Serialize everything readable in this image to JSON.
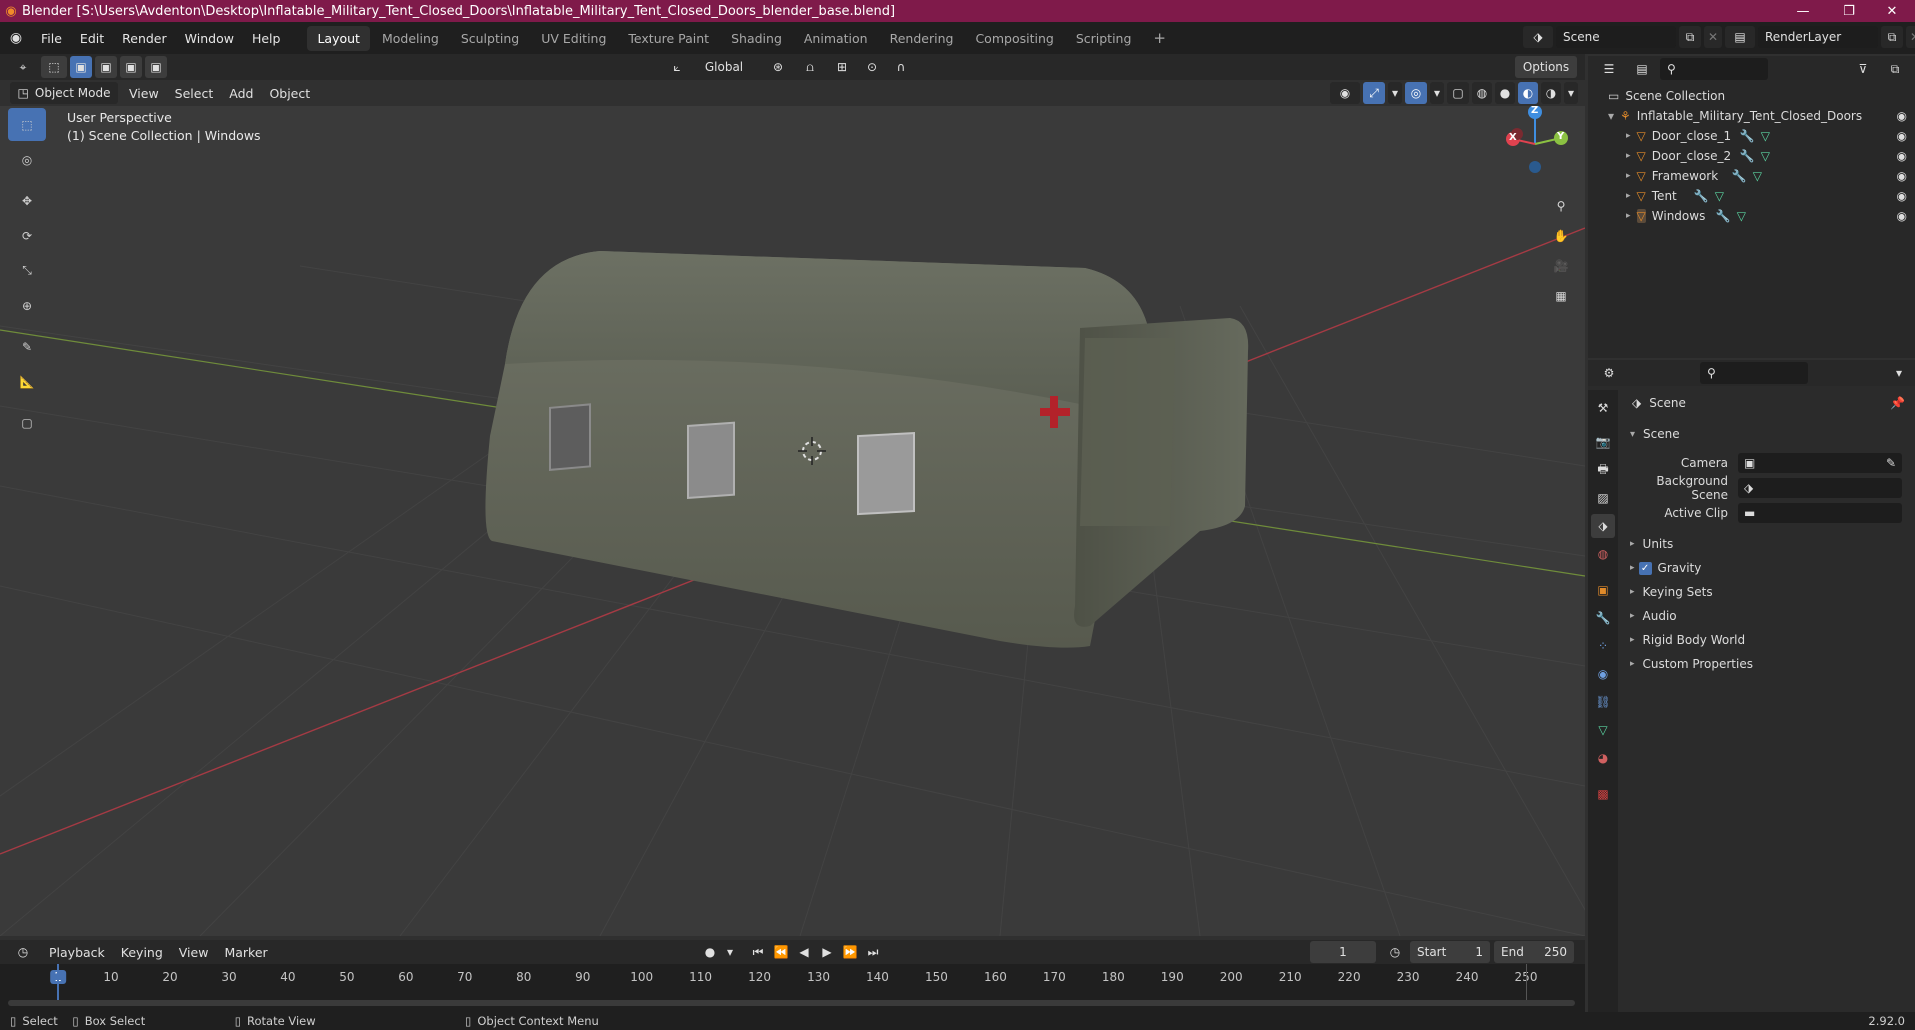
{
  "window": {
    "title": "Blender [S:\\Users\\Avdenton\\Desktop\\Inflatable_Military_Tent_Closed_Doors\\Inflatable_Military_Tent_Closed_Doors_blender_base.blend]"
  },
  "menus": [
    "File",
    "Edit",
    "Render",
    "Window",
    "Help"
  ],
  "workspaces": [
    "Layout",
    "Modeling",
    "Sculpting",
    "UV Editing",
    "Texture Paint",
    "Shading",
    "Animation",
    "Rendering",
    "Compositing",
    "Scripting"
  ],
  "active_workspace": "Layout",
  "scene_selector": {
    "value": "Scene"
  },
  "view_layer_selector": {
    "value": "RenderLayer"
  },
  "viewport_header": {
    "transform_orientation": "Global",
    "options_label": "Options",
    "mode": "Object Mode",
    "menus": [
      "View",
      "Select",
      "Add",
      "Object"
    ]
  },
  "viewport": {
    "perspective_label": "User Perspective",
    "collection_label": "(1) Scene Collection | Windows",
    "gizmo_axes": {
      "x": "X",
      "y": "Y",
      "z": "Z"
    }
  },
  "outliner": {
    "root": "Scene Collection",
    "collection": "Inflatable_Military_Tent_Closed_Doors",
    "objects": [
      "Door_close_1",
      "Door_close_2",
      "Framework",
      "Tent",
      "Windows"
    ]
  },
  "properties": {
    "context_label": "Scene",
    "panel_title": "Scene",
    "fields": {
      "camera": "Camera",
      "background_scene": "Background Scene",
      "active_clip": "Active Clip"
    },
    "sections": [
      "Units",
      "Gravity",
      "Keying Sets",
      "Audio",
      "Rigid Body World",
      "Custom Properties"
    ],
    "gravity_enabled": true
  },
  "timeline": {
    "menus": [
      "Playback",
      "Keying",
      "View",
      "Marker"
    ],
    "current_frame": "1",
    "start_label": "Start",
    "start": "1",
    "end_label": "End",
    "end": "250",
    "ticks": [
      "1",
      "10",
      "20",
      "30",
      "40",
      "50",
      "60",
      "70",
      "80",
      "90",
      "100",
      "110",
      "120",
      "130",
      "140",
      "150",
      "160",
      "170",
      "180",
      "190",
      "200",
      "210",
      "220",
      "230",
      "240",
      "250"
    ]
  },
  "statusbar": {
    "select": "Select",
    "box_select": "Box Select",
    "rotate_view": "Rotate View",
    "context_menu": "Object Context Menu",
    "version": "2.92.0"
  },
  "colors": {
    "title_bar": "#7f1a4a",
    "accent_blue": "#4772b3",
    "axis_x": "#e0424f",
    "axis_y": "#8bc142",
    "axis_z": "#3f8ee0"
  }
}
